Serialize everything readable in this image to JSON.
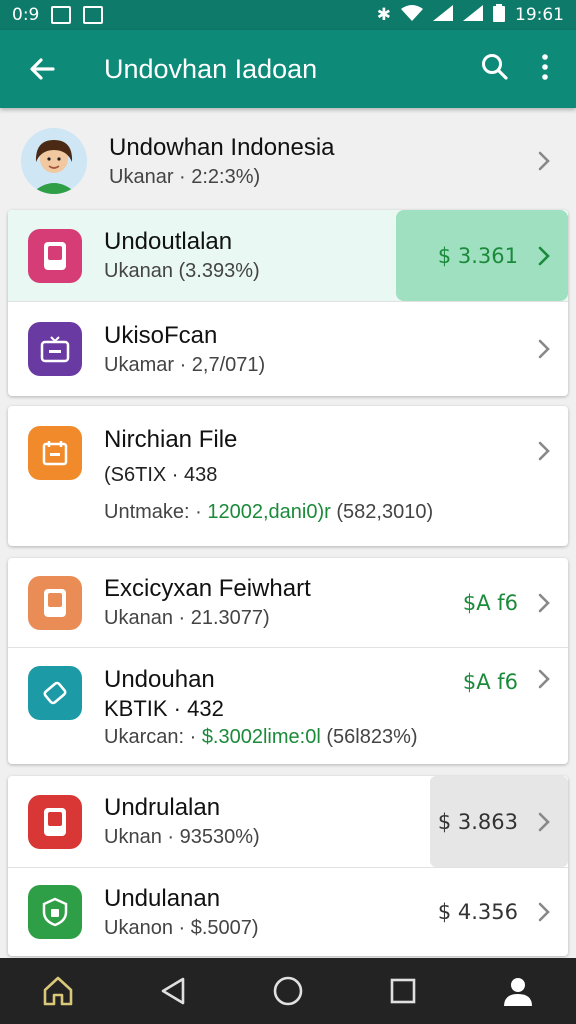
{
  "status_bar": {
    "left_text": "0:9",
    "time": "19:61"
  },
  "app_bar": {
    "title": "Undovhan Iadoan"
  },
  "profile": {
    "name": "Undowhan Indonesia",
    "sub": "Ukanar · 2:2:3%)"
  },
  "group1": [
    {
      "title": "Undoutlalan",
      "sub": "Ukanan (3.393%)",
      "price": "$ 3.361",
      "icon": "phone-app-icon",
      "color": "#d63c75"
    },
    {
      "title": "UkisoFcan",
      "sub": "Ukamar · 2,7/071)",
      "icon": "tv-app-icon",
      "color": "#6a3aa3"
    }
  ],
  "file": {
    "title": "Nirchian File",
    "sub": "(S6TIX · 438",
    "meta_label": "Untmake: ·",
    "meta_value": "12002,dani0)r",
    "meta_extra": "(582,3010)",
    "icon": "calendar-app-icon",
    "color": "#f08a2a"
  },
  "group2": [
    {
      "title": "Excicyxan Feiwhart",
      "sub": "Ukanan · 21.3077)",
      "price": "$A f6",
      "icon": "phone-app-icon",
      "color": "#ea8c55"
    },
    {
      "title": "Undouhan",
      "sub": "KBTIK · 432",
      "meta_label": "Ukarcan: ·",
      "meta_value": "$.3002lime:0l",
      "meta_extra": "(56l823%)",
      "price": "$A f6",
      "icon": "ticket-app-icon",
      "color": "#1c9aa6"
    }
  ],
  "group3": [
    {
      "title": "Undrulalan",
      "sub": "Uknan · 93530%)",
      "price": "$ 3.863",
      "icon": "phone-app-icon",
      "color": "#d93636"
    },
    {
      "title": "Undulanan",
      "sub": "Ukanon · $.5007)",
      "price": "$ 4.356",
      "icon": "shield-app-icon",
      "color": "#2e9e47"
    }
  ],
  "colors": {
    "app_bar": "#0d8a78",
    "status_bar": "#0e7a6a",
    "price_green": "#1b8a3a",
    "highlight_green": "#9ee0c0",
    "highlight_gray": "#e6e6e6"
  }
}
